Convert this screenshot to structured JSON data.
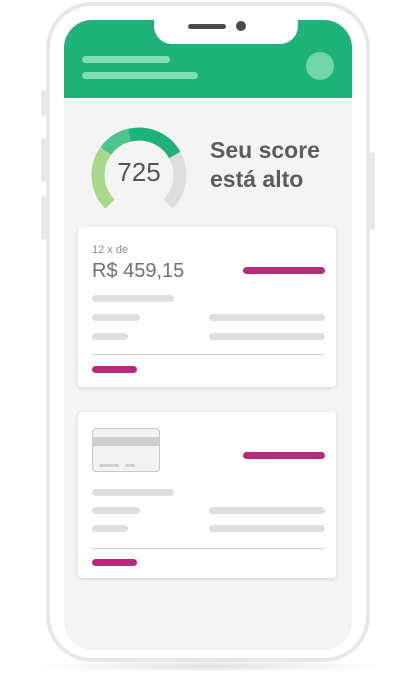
{
  "score": {
    "value": "725",
    "headline": "Seu score está alto",
    "gauge_fill_fraction": 0.725,
    "colors": {
      "low": "#a8d98a",
      "mid": "#4cc58c",
      "high": "#1eb279",
      "track": "#dddddd"
    }
  },
  "offer_card": {
    "installments": "12 x de",
    "amount": "R$ 459,15"
  },
  "colors": {
    "header": "#1eb279",
    "accent": "#b52b7a",
    "placeholder": "#dedede",
    "screen_background": "#f4f4f4"
  },
  "icons": [
    "avatar-icon",
    "credit-card-icon",
    "score-gauge-icon"
  ]
}
